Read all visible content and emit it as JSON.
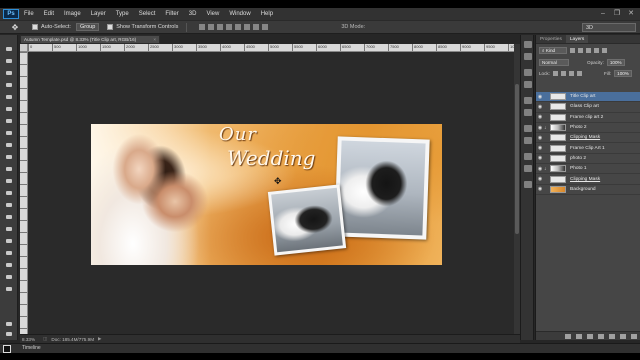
{
  "app": {
    "logo": "Ps",
    "menu": [
      "File",
      "Edit",
      "Image",
      "Layer",
      "Type",
      "Select",
      "Filter",
      "3D",
      "View",
      "Window",
      "Help"
    ],
    "window_controls": [
      "–",
      "❐",
      "✕"
    ]
  },
  "options_bar": {
    "auto_select_label": "Auto-Select:",
    "auto_select_value": "Group",
    "transform_controls_label": "Show Transform Controls",
    "mode_3d_label": "3D Mode:",
    "workspace_value": "3D"
  },
  "document": {
    "tab_title": "Autumn Template.psd @ 8.33% (Title Clip art, RGB/16)",
    "zoom": "8.33%",
    "doc_size": "Doc: 185.4M/775.9M"
  },
  "ruler": {
    "h_ticks": [
      "0",
      "500",
      "1000",
      "1500",
      "2000",
      "2500",
      "3000",
      "3500",
      "4000",
      "4500",
      "5000",
      "5500",
      "6000",
      "6500",
      "7000",
      "7500",
      "8000",
      "8500",
      "9000",
      "9500",
      "10000"
    ]
  },
  "canvas": {
    "title_line1": "Our",
    "title_line2": "Wedding"
  },
  "panel": {
    "tabs": [
      "Properties",
      "Layers"
    ],
    "active_tab": "Layers",
    "filter_kind": "Kind",
    "blend_mode": "Normal",
    "opacity_label": "Opacity:",
    "opacity_value": "100%",
    "lock_label": "Lock:",
    "fill_label": "Fill:",
    "fill_value": "100%",
    "layers": [
      {
        "name": "Title Clip art",
        "selected": true,
        "clipped": false,
        "underline": false,
        "thumb": "txt"
      },
      {
        "name": "Glass Clip art",
        "selected": false,
        "clipped": false,
        "underline": false,
        "thumb": "txt"
      },
      {
        "name": "Frame clip art 2",
        "selected": false,
        "clipped": false,
        "underline": false,
        "thumb": "txt"
      },
      {
        "name": "Photo 2",
        "selected": false,
        "clipped": true,
        "underline": false,
        "thumb": "img"
      },
      {
        "name": "Clipping Mask",
        "selected": false,
        "clipped": false,
        "underline": true,
        "thumb": "txt"
      },
      {
        "name": "Frame Clip Art 1",
        "selected": false,
        "clipped": false,
        "underline": false,
        "thumb": "txt"
      },
      {
        "name": "photo 2",
        "selected": false,
        "clipped": false,
        "underline": false,
        "thumb": "txt"
      },
      {
        "name": "Photo 1",
        "selected": false,
        "clipped": true,
        "underline": false,
        "thumb": "img"
      },
      {
        "name": "Clipping Mask",
        "selected": false,
        "clipped": false,
        "underline": true,
        "thumb": "txt"
      },
      {
        "name": "Background",
        "selected": false,
        "clipped": false,
        "underline": false,
        "thumb": "bg"
      }
    ]
  },
  "timeline_label": "Timeline",
  "colors": {
    "app_bg": "#262626",
    "panel_bg": "#464646",
    "selection": "#4a6f9c",
    "canvas_orange": "#e08f2a"
  }
}
